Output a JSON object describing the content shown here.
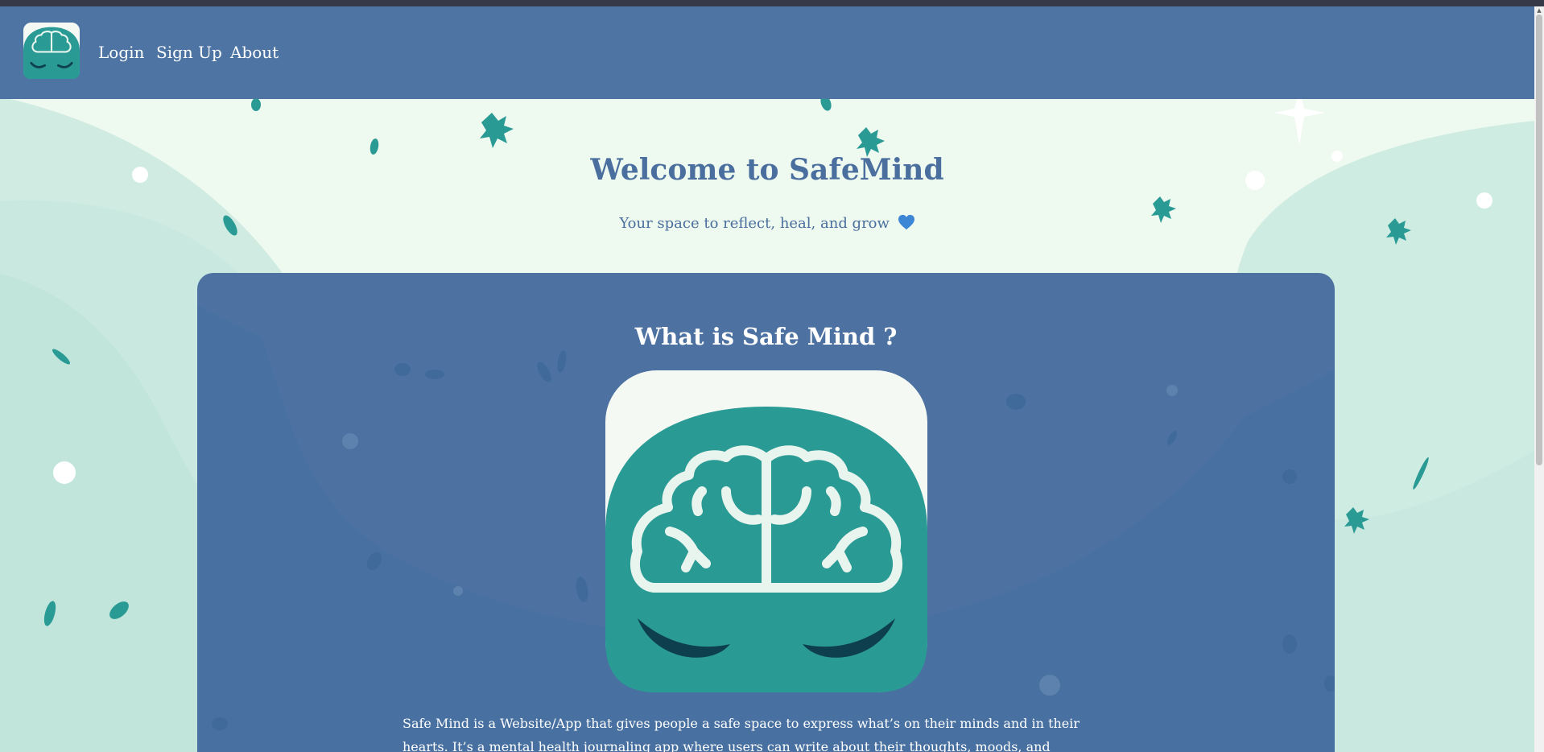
{
  "nav": {
    "links": [
      "Login",
      "Sign Up",
      "About"
    ]
  },
  "hero": {
    "title": "Welcome to SafeMind",
    "subtitle": "Your space to reflect, heal, and grow",
    "subtitle_emoji": "blue-heart-icon"
  },
  "card": {
    "title": "What is Safe Mind ?",
    "body": "Safe Mind is a Website/App that gives people a safe space to express what’s on their minds and in their hearts. It’s a mental health journaling app where users can write about their thoughts, moods, and struggles — freely and without judgment. So"
  },
  "colors": {
    "navbar": "#4d74a3",
    "background": "#eef9ef",
    "accent_teal": "#2a9a95",
    "card": "#4d72a2",
    "title_blue": "#4a6f9e"
  },
  "icons": [
    "brain-logo-icon",
    "blue-heart-icon",
    "leaf-icon"
  ]
}
